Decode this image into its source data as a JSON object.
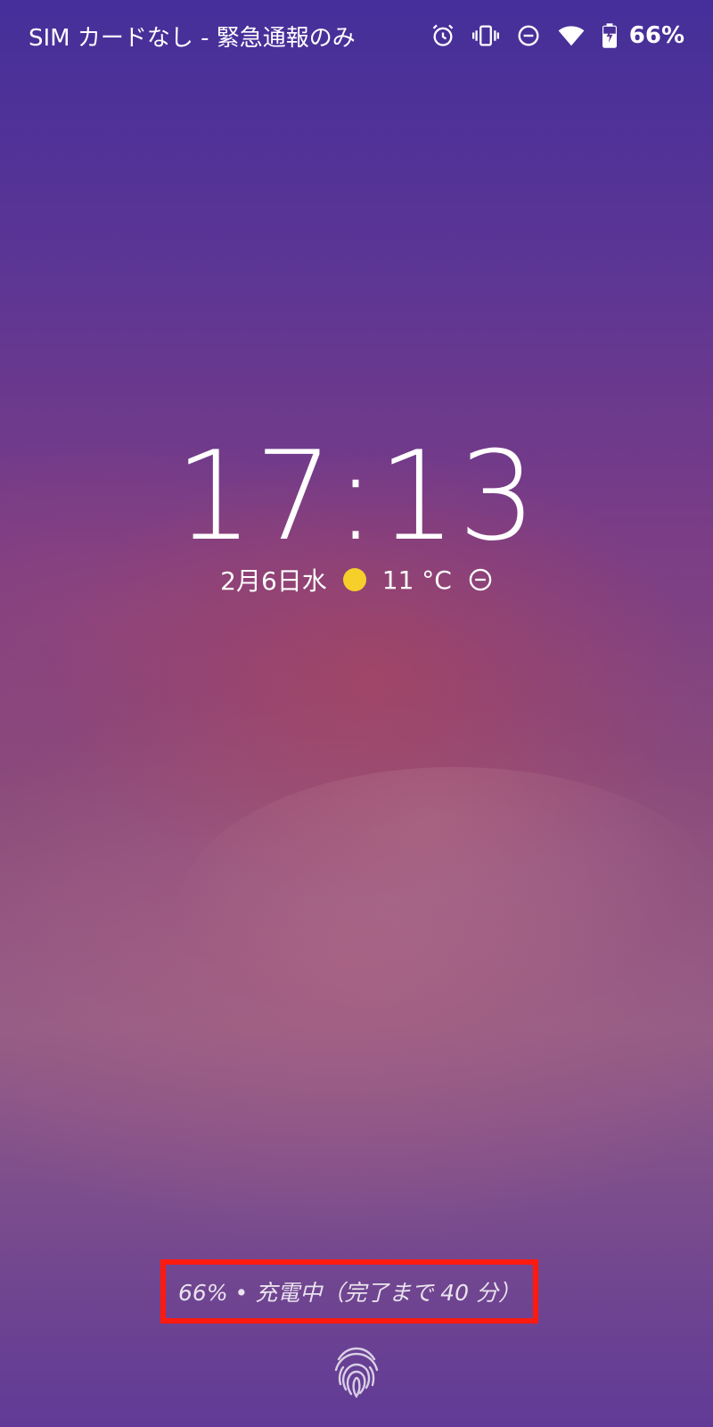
{
  "status_bar": {
    "carrier_text": "SIM カードなし - 緊急通報のみ",
    "battery_percent": "66%",
    "icons": [
      "alarm-icon",
      "vibrate-icon",
      "dnd-icon",
      "wifi-icon",
      "battery-charging-icon"
    ]
  },
  "lockscreen": {
    "time": "17:13",
    "date": "2月6日水",
    "weather_icon": "sun-icon",
    "temperature": "11 °C",
    "status_icon": "dnd-icon"
  },
  "charging": {
    "text": "66% • 充電中（完了まで 40 分）"
  },
  "fingerprint_icon": "fingerprint-icon",
  "colors": {
    "highlight_border": "#ff1a10",
    "sun": "#f6cf2b"
  }
}
